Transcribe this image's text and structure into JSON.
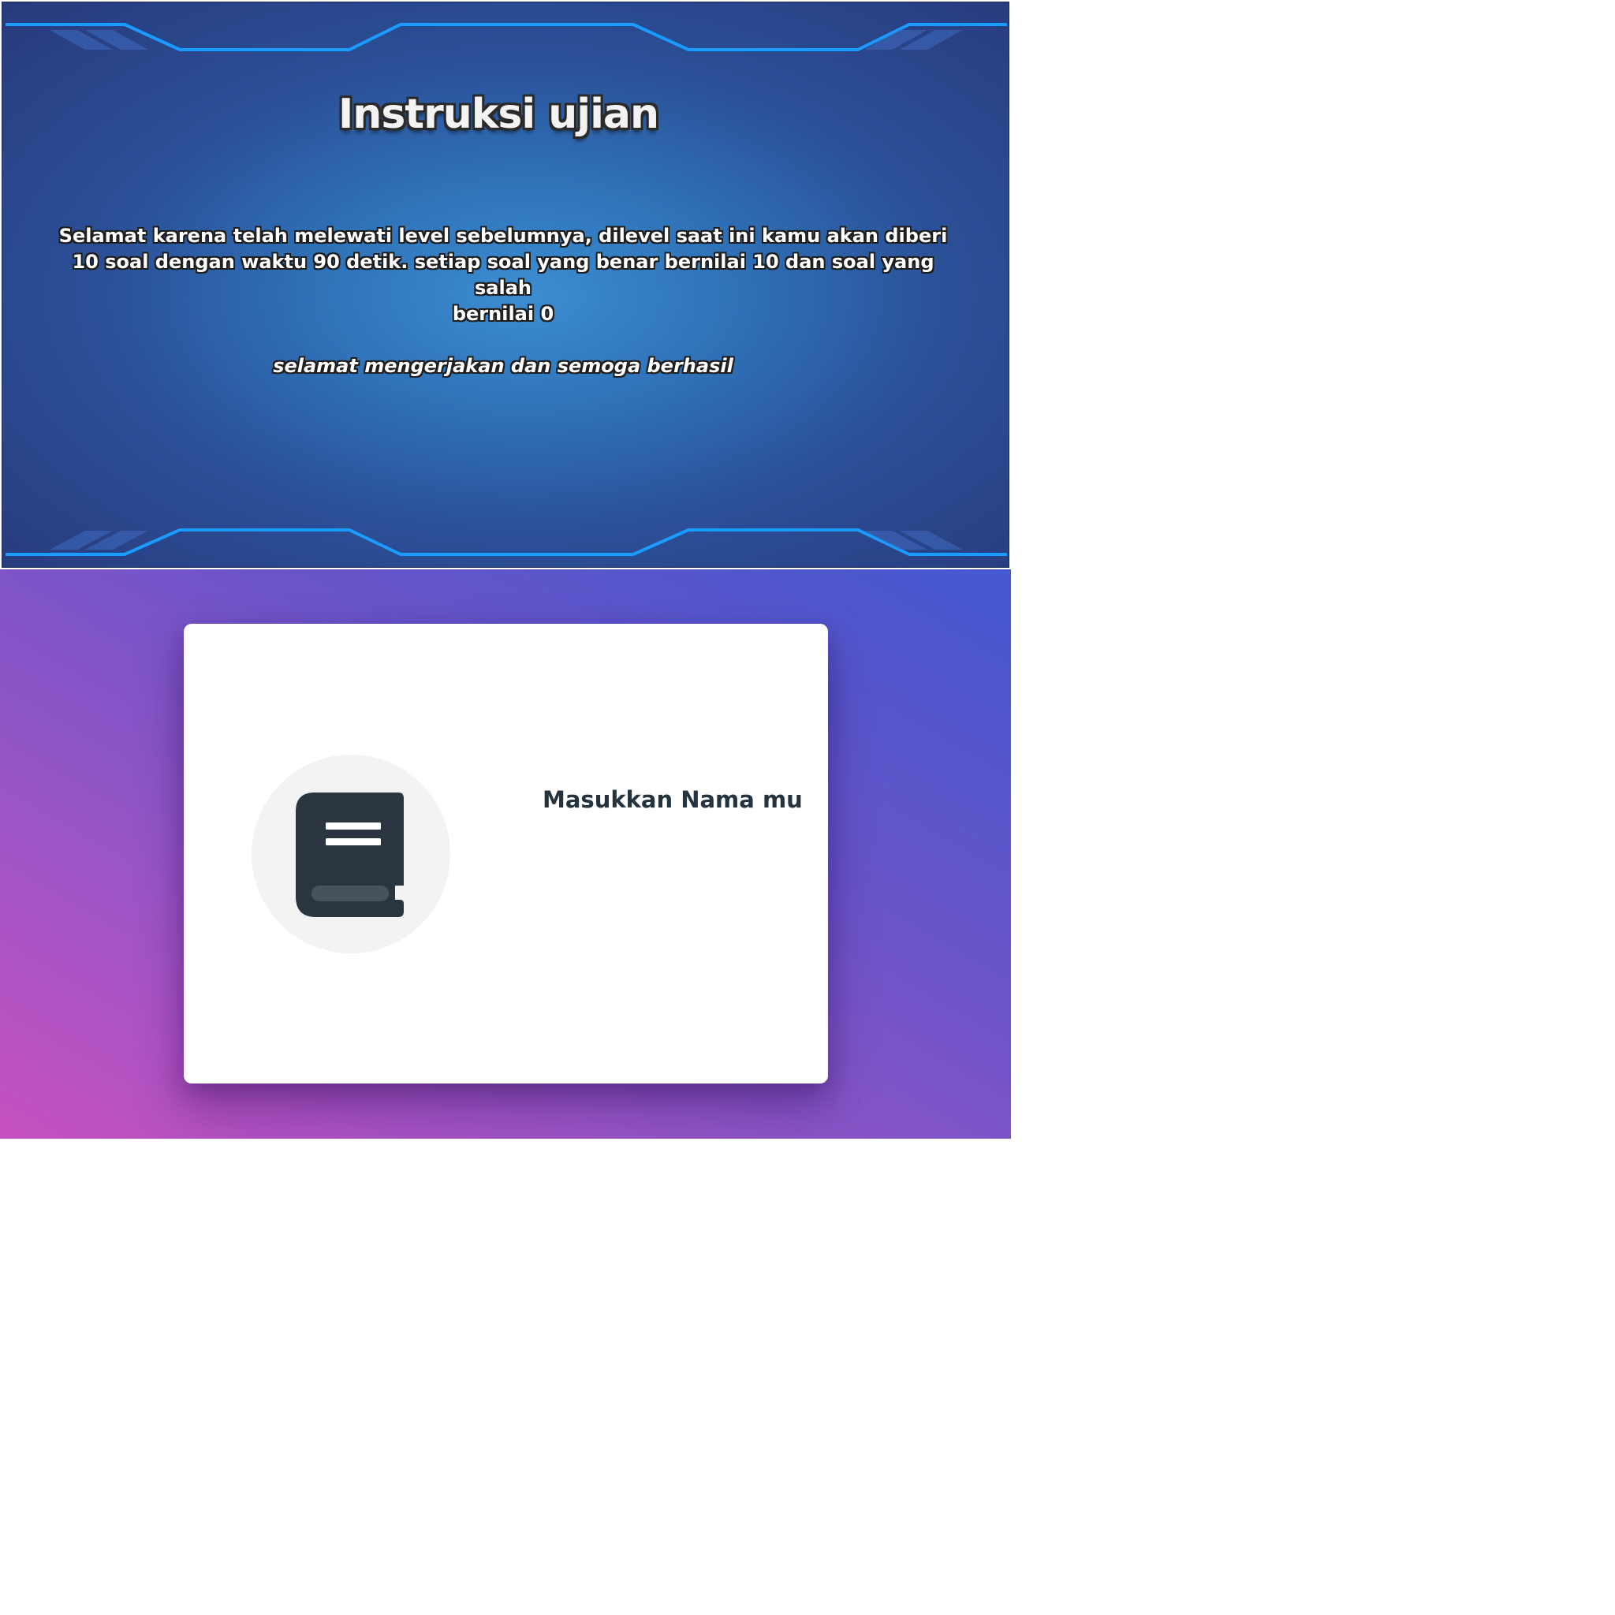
{
  "instructions": {
    "title": "Instruksi ujian",
    "paragraph_lines": [
      "Selamat karena telah melewati level sebelumnya, dilevel saat ini kamu akan diberi",
      "10 soal dengan waktu 90 detik. setiap soal yang benar bernilai 10 dan soal yang salah",
      "bernilai 0"
    ],
    "closing": "selamat mengerjakan dan semoga berhasil"
  },
  "name_entry": {
    "prompt": "Masukkan Nama mu",
    "icon": "book-icon"
  },
  "colors": {
    "banner_glow": "#3c8dd2",
    "banner_edge": "#283a7c",
    "frame_line": "#1a9bff",
    "gradient_pink": "#c650c0",
    "gradient_blue": "#4458d0",
    "card": "#ffffff",
    "icon_dark": "#2b3540",
    "prompt_text": "#25333f"
  }
}
